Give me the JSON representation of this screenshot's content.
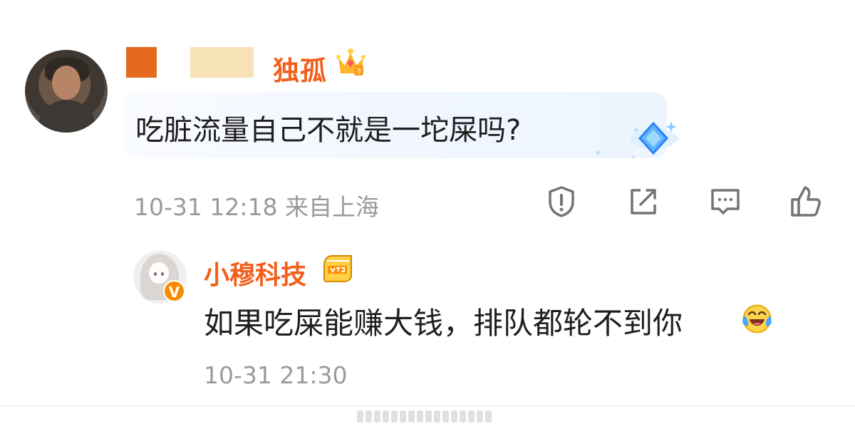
{
  "main_comment": {
    "username_visible": "独孤",
    "text": "吃脏流量自己不就是一坨屎吗?",
    "time": "10-31 12:18",
    "location": "来自上海",
    "icons": [
      "report-icon",
      "share-icon",
      "reply-icon",
      "like-icon"
    ]
  },
  "reply": {
    "username": "小穆科技",
    "text": "如果吃屎能赚大钱，排队都轮不到你",
    "time": "10-31 21:30",
    "verified_badge": "V",
    "emoji": "laughing-crying-emoji"
  },
  "colors": {
    "username": "#f25f1a",
    "accent": "#f78b00",
    "text": "#1e1e1e",
    "meta": "#9a9a9a",
    "divider": "#ededed"
  }
}
